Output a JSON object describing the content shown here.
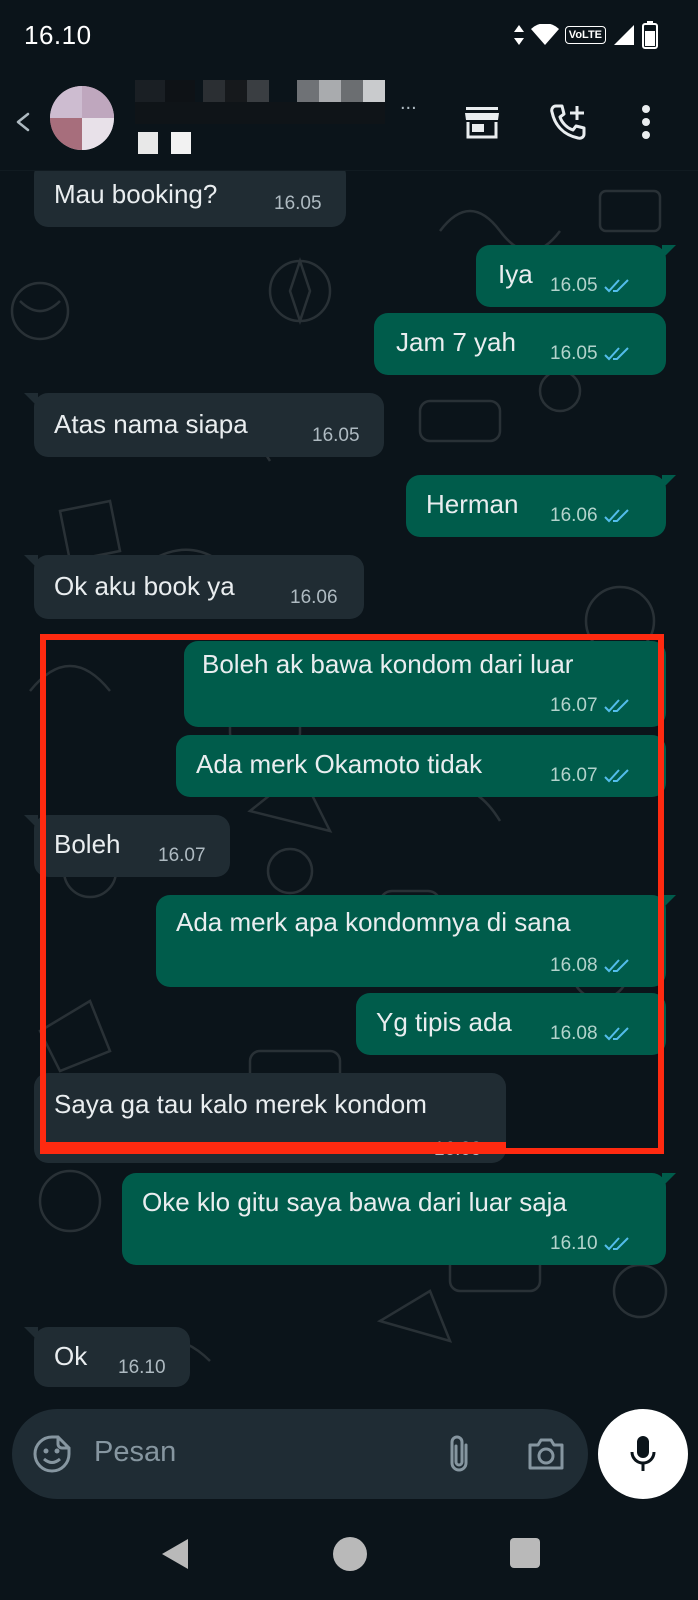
{
  "status_bar": {
    "time": "16.10",
    "network_label": "VoLTE"
  },
  "header": {
    "contact_name_suffix": "...",
    "icons": [
      "back-arrow-icon",
      "store-icon",
      "add-call-icon",
      "more-vert-icon"
    ]
  },
  "messages": [
    {
      "direction": "in",
      "text": "Mau booking?",
      "time": "16.05"
    },
    {
      "direction": "out",
      "text": "Iya",
      "time": "16.05",
      "status": "read"
    },
    {
      "direction": "out",
      "text": "Jam 7 yah",
      "time": "16.05",
      "status": "read"
    },
    {
      "direction": "in",
      "text": "Atas nama siapa",
      "time": "16.05"
    },
    {
      "direction": "out",
      "text": "Herman",
      "time": "16.06",
      "status": "read"
    },
    {
      "direction": "in",
      "text": "Ok aku book ya",
      "time": "16.06"
    },
    {
      "direction": "out",
      "text": "Boleh ak bawa kondom dari luar",
      "time": "16.07",
      "status": "read"
    },
    {
      "direction": "out",
      "text": "Ada merk Okamoto tidak",
      "time": "16.07",
      "status": "read"
    },
    {
      "direction": "in",
      "text": "Boleh",
      "time": "16.07"
    },
    {
      "direction": "out",
      "text": "Ada merk apa kondomnya di sana",
      "time": "16.08",
      "status": "read"
    },
    {
      "direction": "out",
      "text": "Yg tipis ada",
      "time": "16.08",
      "status": "read"
    },
    {
      "direction": "in",
      "text": "Saya ga tau kalo merek kondom",
      "time": "16.09"
    },
    {
      "direction": "out",
      "text": "Oke klo gitu saya bawa dari luar saja",
      "time": "16.10",
      "status": "read"
    },
    {
      "direction": "in",
      "text": "Ok",
      "time": "16.10"
    }
  ],
  "annotation": {
    "color": "#ff2a10"
  },
  "composer": {
    "placeholder": "Pesan",
    "icons": [
      "emoji-sticker-icon",
      "attach-icon",
      "camera-icon",
      "mic-icon"
    ]
  },
  "colors": {
    "background": "#0b141a",
    "incoming_bubble": "#202c33",
    "outgoing_bubble": "#005c4b",
    "read_ticks": "#53bdeb"
  }
}
